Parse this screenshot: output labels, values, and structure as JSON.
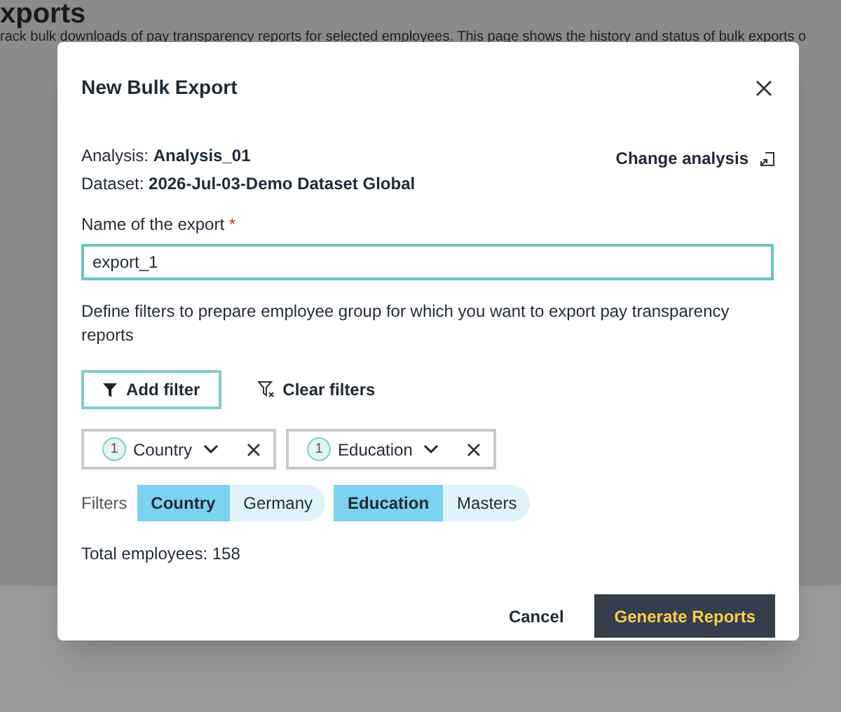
{
  "page": {
    "title": "xports",
    "description": "rack bulk downloads of pay transparency reports for selected employees. This page shows the history and status of bulk exports o"
  },
  "dialog": {
    "title": "New Bulk Export",
    "analysis": {
      "label": "Analysis:",
      "value": "Analysis_01"
    },
    "dataset": {
      "label": "Dataset:",
      "value": "2026-Jul-03-Demo Dataset Global"
    },
    "change_analysis": "Change analysis",
    "name_field": {
      "label": "Name of the export",
      "required_mark": "*",
      "value": "export_1"
    },
    "instructions": "Define filters to prepare employee group for which you want to export pay transparency reports",
    "add_filter": "Add filter",
    "clear_filters": "Clear filters",
    "filter_dropdowns": [
      {
        "count": "1",
        "label": "Country"
      },
      {
        "count": "1",
        "label": "Education"
      }
    ],
    "filters_label": "Filters",
    "filter_tags": [
      {
        "field": "Country",
        "value": "Germany"
      },
      {
        "field": "Education",
        "value": "Masters"
      }
    ],
    "total": "Total employees: 158",
    "cancel": "Cancel",
    "generate": "Generate Reports"
  }
}
